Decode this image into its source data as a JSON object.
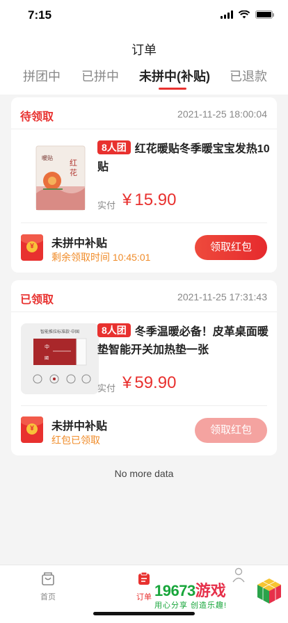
{
  "status_bar": {
    "time": "7:15"
  },
  "header": {
    "title": "订单",
    "tabs": [
      {
        "label": "拼团中"
      },
      {
        "label": "已拼中"
      },
      {
        "label": "未拼中(补贴)"
      },
      {
        "label": "已退款"
      }
    ],
    "active_tab_index": 2
  },
  "orders": [
    {
      "status": "待领取",
      "date": "2021-11-25 18:00:04",
      "badge": "8人团",
      "product_title": "红花暖贴冬季暖宝宝发热10贴",
      "pay_label": "实付",
      "currency": "¥",
      "price": "15.90",
      "subsidy_title": "未拼中补贴",
      "subsidy_sub": "剩余领取时间 10:45:01",
      "claim_label": "领取红包",
      "claim_enabled": true
    },
    {
      "status": "已领取",
      "date": "2021-11-25 17:31:43",
      "badge": "8人团",
      "product_title": "冬季温暖必备！皮革桌面暖垫智能开关加热垫一张",
      "pay_label": "实付",
      "currency": "¥",
      "price": "59.90",
      "subsidy_title": "未拼中补贴",
      "subsidy_sub": "红包已领取",
      "claim_label": "领取红包",
      "claim_enabled": false
    }
  ],
  "footer_note": "No more data",
  "tabbar": {
    "items": [
      {
        "label": "首页",
        "icon": "bag-icon"
      },
      {
        "label": "订单",
        "icon": "order-icon"
      }
    ]
  },
  "watermark": {
    "number": "19673",
    "text": "游戏",
    "slogan": "用心分享 创造乐趣!"
  },
  "colors": {
    "accent": "#e8312f",
    "orange": "#f08c2a",
    "background": "#f4f4f4"
  }
}
